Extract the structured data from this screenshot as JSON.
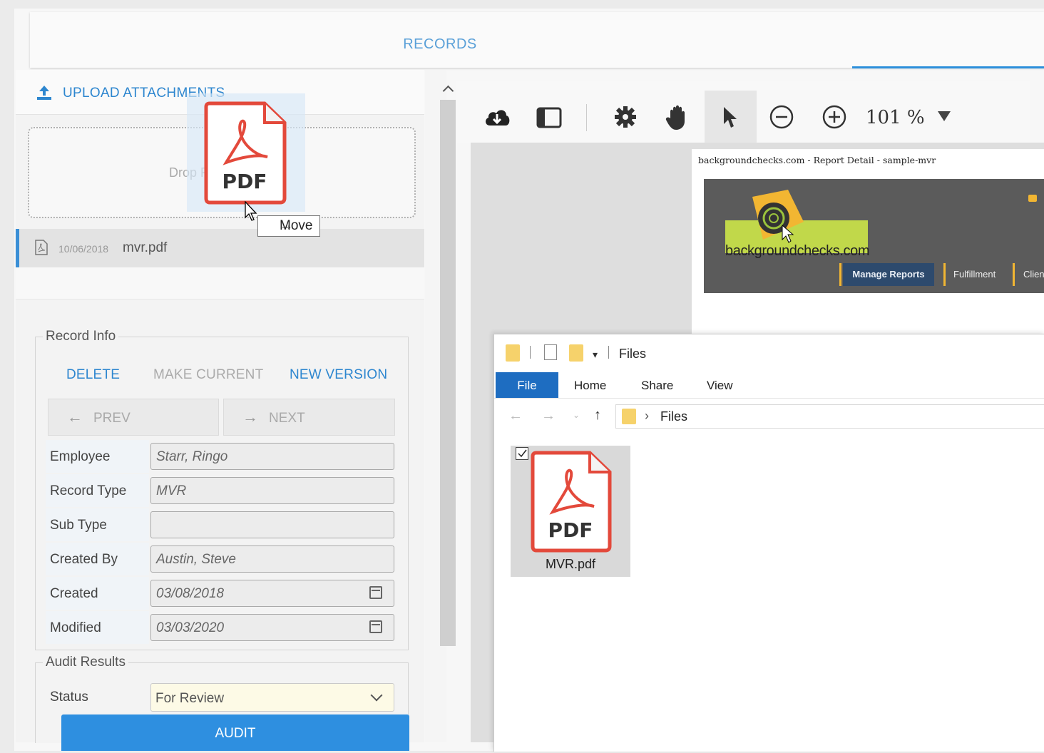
{
  "tabs": {
    "records": "RECORDS"
  },
  "upload": {
    "label": "UPLOAD ATTACHMENTS",
    "drop_hint": "Drop Files Here"
  },
  "attachment": {
    "date": "10/06/2018",
    "name": "mvr.pdf"
  },
  "record_info": {
    "legend": "Record Info",
    "actions": {
      "delete": "DELETE",
      "make_current": "MAKE CURRENT",
      "new_version": "NEW VERSION"
    },
    "prev": "PREV",
    "next": "NEXT",
    "fields": [
      {
        "label": "Employee",
        "value": "Starr, Ringo"
      },
      {
        "label": "Record Type",
        "value": "MVR"
      },
      {
        "label": "Sub Type",
        "value": ""
      },
      {
        "label": "Created By",
        "value": "Austin, Steve"
      },
      {
        "label": "Created",
        "value": "03/08/2018"
      },
      {
        "label": "Modified",
        "value": "03/03/2020"
      }
    ]
  },
  "audit_results": {
    "legend": "Audit Results",
    "status_label": "Status",
    "status_value": "For Review",
    "button": "AUDIT"
  },
  "viewer": {
    "zoom": "101 %",
    "doc_title": "backgroundchecks.com - Report Detail - sample-mvr",
    "logo_text": "backgroundchecks.com",
    "nav": {
      "manage_reports": "Manage Reports",
      "fulfillment": "Fulfillment",
      "clients": "Clien"
    }
  },
  "explorer": {
    "title": "Files",
    "ribbon": {
      "file": "File",
      "home": "Home",
      "share": "Share",
      "view": "View"
    },
    "path": "Files",
    "file_label": "MVR.pdf"
  },
  "drag": {
    "ghost_label": "PDF",
    "tooltip": "Move"
  },
  "icons": {
    "pdf_badge": "PDF",
    "colors": {
      "accent": "#2e8fe0",
      "pdf_red": "#e3493b",
      "folder": "#f6d26b"
    }
  }
}
